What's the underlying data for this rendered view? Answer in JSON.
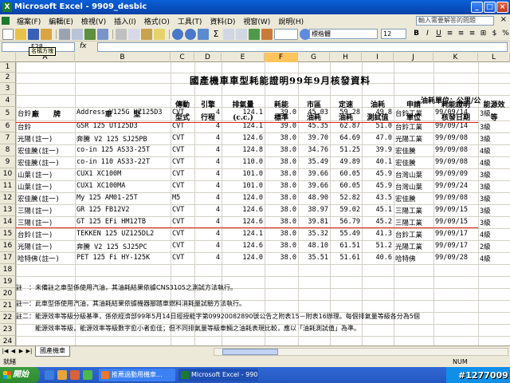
{
  "window": {
    "title": "Microsoft Excel - 9909_desbic"
  },
  "menu": [
    "檔案(F)",
    "編輯(E)",
    "檢視(V)",
    "插入(I)",
    "格式(O)",
    "工具(T)",
    "資料(D)",
    "視窗(W)",
    "說明(H)"
  ],
  "help_box": "輸入需要解答的問題",
  "toolbar": {
    "font": "標楷體",
    "size": "12",
    "bold": "B",
    "italic": "I",
    "underline": "U"
  },
  "formula": {
    "namebox": "F28",
    "namebox_tip": "名稱方塊",
    "fx": "fx"
  },
  "columns": [
    "A",
    "B",
    "C",
    "D",
    "E",
    "F",
    "G",
    "H",
    "I",
    "J",
    "K",
    "L"
  ],
  "rows": [
    "1",
    "2",
    "3",
    "4",
    "5",
    "6",
    "7",
    "8",
    "9",
    "10",
    "11",
    "12",
    "13",
    "14",
    "15",
    "16",
    "17",
    "18",
    "19",
    "20",
    "21",
    "22",
    "23",
    "24"
  ],
  "sheet": {
    "title": "國產機車車型耗能證明99年9月核發資料",
    "unit": "油耗單位：公里/公",
    "headers": {
      "brand": "廠　　牌",
      "model": "車　　　型",
      "trans1": "傳動",
      "trans2": "型式",
      "stroke1": "引擎",
      "stroke2": "行程",
      "cc1": "排氣量",
      "cc2": "(c.c.)",
      "std1": "耗能",
      "std2": "標準",
      "city1": "市區",
      "city2": "油耗",
      "const1": "定速",
      "const2": "油耗",
      "test1": "油耗",
      "test2": "測試值",
      "apply1": "申請",
      "apply2": "單位",
      "date1": "耗能證明",
      "date2": "核發日期",
      "grade1": "能源效",
      "grade2": "等"
    },
    "data": [
      [
        "台鈴",
        "Address V125G UZ125D3",
        "CVT",
        "4",
        "124.1",
        "39.0",
        "45.03",
        "59.28",
        "49.8",
        "台鈴工業",
        "99/09/14",
        "3級"
      ],
      [
        "台鈴",
        "GSR 125 UTI25D3",
        "CVT",
        "4",
        "124.1",
        "39.0",
        "45.35",
        "62.87",
        "51.0",
        "台鈴工業",
        "99/09/14",
        "3級"
      ],
      [
        "光陽(註一)",
        "奔騰 V2 125 SJ25PB",
        "CVT",
        "4",
        "124.6",
        "38.0",
        "39.70",
        "64.69",
        "47.0",
        "光陽工業",
        "99/09/08",
        "3級"
      ],
      [
        "宏佳騰(註一)",
        "co-in 125 AS33-25T",
        "CVT",
        "4",
        "124.8",
        "38.0",
        "34.76",
        "51.25",
        "39.9",
        "宏佳騰",
        "99/09/08",
        "4級"
      ],
      [
        "宏佳騰(註一)",
        "co-in 110 AS33-22T",
        "CVT",
        "4",
        "110.0",
        "38.0",
        "35.49",
        "49.89",
        "40.1",
        "宏佳騰",
        "99/09/08",
        "4級"
      ],
      [
        "山葉(註一)",
        "CUX1 XC100M",
        "CVT",
        "4",
        "101.0",
        "38.0",
        "39.66",
        "60.05",
        "45.9",
        "台灣山葉",
        "99/09/09",
        "3級"
      ],
      [
        "山葉(註一)",
        "CUX1 XC100MA",
        "CVT",
        "4",
        "101.0",
        "38.0",
        "39.66",
        "60.05",
        "45.9",
        "台灣山葉",
        "99/09/24",
        "3級"
      ],
      [
        "宏佳騰(註一)",
        "My 125 AM01-25T",
        "M5",
        "4",
        "124.0",
        "38.0",
        "48.90",
        "52.82",
        "43.5",
        "宏佳騰",
        "99/09/08",
        "3級"
      ],
      [
        "三陽(註一)",
        "GR 125 FB12V2",
        "CVT",
        "4",
        "124.6",
        "38.0",
        "38.97",
        "59.02",
        "45.1",
        "三陽工業",
        "99/09/15",
        "3級"
      ],
      [
        "三陽(註一)",
        "GT 125 EFi HM12TB",
        "CVT",
        "4",
        "124.6",
        "38.0",
        "39.81",
        "56.79",
        "45.2",
        "三陽工業",
        "99/09/15",
        "3級"
      ],
      [
        "台鈴(註一)",
        "TEKKEN 125 UZ125DL2",
        "CVT",
        "4",
        "124.1",
        "38.0",
        "35.32",
        "55.49",
        "41.3",
        "台鈴工業",
        "99/09/17",
        "4級"
      ],
      [
        "光陽(註一)",
        "奔騰 V2 125 SJ25PC",
        "CVT",
        "4",
        "124.6",
        "38.0",
        "48.10",
        "61.51",
        "51.2",
        "光陽工業",
        "99/09/17",
        "2級"
      ],
      [
        "哈特佛(註一)",
        "PET 125 Fi HY-125K",
        "CVT",
        "4",
        "124.0",
        "38.0",
        "35.51",
        "51.61",
        "40.6",
        "哈特佛",
        "99/09/28",
        "4級"
      ]
    ],
    "notes": [
      "註　：未備註之車型係使用汽油，其油耗結果依據CNS3105之測試方法執行。",
      "註一：此車型係使用汽油，其油耗結果依據機器腳踏車燃料消耗量試驗方法執行。",
      "註二：能源效率等級分級基準，係依經濟部99年5月14日經授能字第09920082890號公告之附表15－附表16辦理。每個排氣量等級各分為5個",
      "　　　能源效率等級，能源效率等級數字愈小者愈佳；但不同排氣量等級車輛之油耗表現比較，應以「油耗測試值」為準。"
    ]
  },
  "sheet_tab": "國產機車",
  "status": {
    "ready": "就緒",
    "num": "NUM"
  },
  "taskbar": {
    "start": "開始",
    "task1": "推薦過動用機車...",
    "task2": "Microsoft Excel - 9909...",
    "clock": "#1277009"
  },
  "colors": {
    "accent_red": "#e0251b",
    "title_blue": "#0842a8"
  }
}
